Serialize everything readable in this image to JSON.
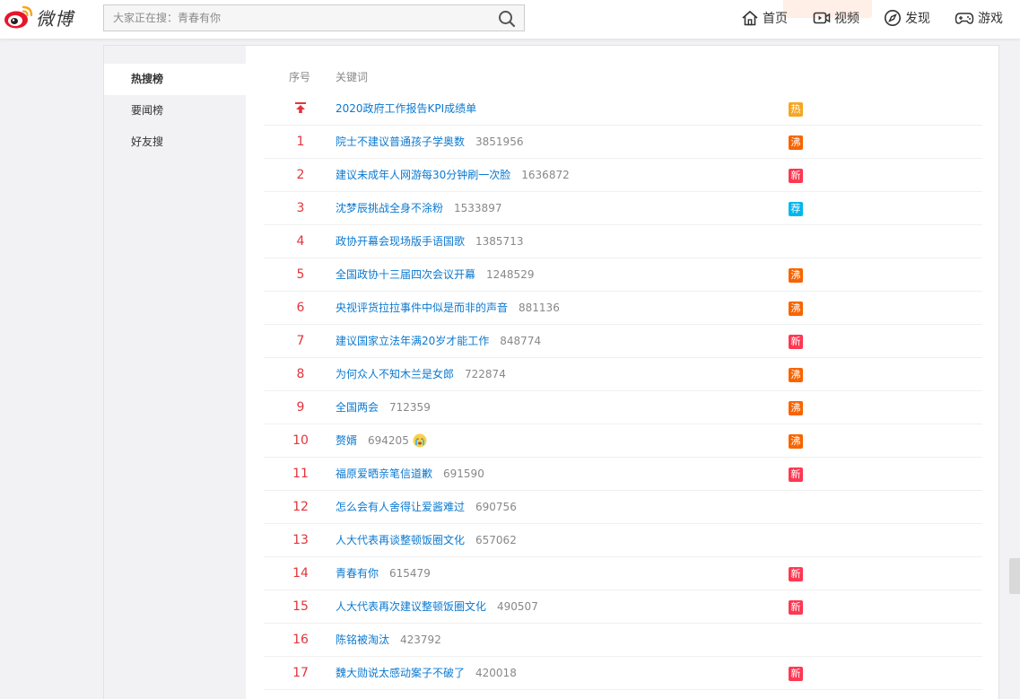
{
  "brand": {
    "name": "微博"
  },
  "search": {
    "placeholder": "大家正在搜：青春有你"
  },
  "nav": [
    {
      "label": "首页",
      "icon": "home-icon"
    },
    {
      "label": "视频",
      "icon": "video-icon"
    },
    {
      "label": "发现",
      "icon": "compass-icon"
    },
    {
      "label": "游戏",
      "icon": "gamepad-icon"
    }
  ],
  "sidebar": {
    "items": [
      {
        "label": "热搜榜",
        "active": true
      },
      {
        "label": "要闻榜",
        "active": false
      },
      {
        "label": "好友搜",
        "active": false
      }
    ]
  },
  "table": {
    "headers": {
      "rank": "序号",
      "keyword": "关键词"
    },
    "pinned": {
      "keyword": "2020政府工作报告KPI成绩单",
      "badge": "热",
      "badge_color": "#f5a623"
    },
    "rows": [
      {
        "rank": "1",
        "keyword": "院士不建议普通孩子学奥数",
        "count": "3851956",
        "badge": "沸",
        "badge_color": "#f86400"
      },
      {
        "rank": "2",
        "keyword": "建议未成年人网游每30分钟刷一次脸",
        "count": "1636872",
        "badge": "新",
        "badge_color": "#ff3852"
      },
      {
        "rank": "3",
        "keyword": "沈梦辰挑战全身不涂粉",
        "count": "1533897",
        "badge": "荐",
        "badge_color": "#00b7ee"
      },
      {
        "rank": "4",
        "keyword": "政协开幕会现场版手语国歌",
        "count": "1385713",
        "badge": "",
        "badge_color": ""
      },
      {
        "rank": "5",
        "keyword": "全国政协十三届四次会议开幕",
        "count": "1248529",
        "badge": "沸",
        "badge_color": "#f86400"
      },
      {
        "rank": "6",
        "keyword": "央视评货拉拉事件中似是而非的声音",
        "count": "881136",
        "badge": "沸",
        "badge_color": "#f86400"
      },
      {
        "rank": "7",
        "keyword": "建议国家立法年满20岁才能工作",
        "count": "848774",
        "badge": "新",
        "badge_color": "#ff3852"
      },
      {
        "rank": "8",
        "keyword": "为何众人不知木兰是女郎",
        "count": "722874",
        "badge": "沸",
        "badge_color": "#f86400"
      },
      {
        "rank": "9",
        "keyword": "全国两会",
        "count": "712359",
        "badge": "沸",
        "badge_color": "#f86400"
      },
      {
        "rank": "10",
        "keyword": "赘婿",
        "count": "694205",
        "badge": "沸",
        "badge_color": "#f86400",
        "emoji": "crying-face-icon"
      },
      {
        "rank": "11",
        "keyword": "福原爱晒亲笔信道歉",
        "count": "691590",
        "badge": "新",
        "badge_color": "#ff3852"
      },
      {
        "rank": "12",
        "keyword": "怎么会有人舍得让爱酱难过",
        "count": "690756",
        "badge": "",
        "badge_color": ""
      },
      {
        "rank": "13",
        "keyword": "人大代表再谈整顿饭圈文化",
        "count": "657062",
        "badge": "",
        "badge_color": ""
      },
      {
        "rank": "14",
        "keyword": "青春有你",
        "count": "615479",
        "badge": "新",
        "badge_color": "#ff3852"
      },
      {
        "rank": "15",
        "keyword": "人大代表再次建议整顿饭圈文化",
        "count": "490507",
        "badge": "新",
        "badge_color": "#ff3852"
      },
      {
        "rank": "16",
        "keyword": "陈铭被淘汰",
        "count": "423792",
        "badge": "",
        "badge_color": ""
      },
      {
        "rank": "17",
        "keyword": "魏大勋说太感动案子不破了",
        "count": "420018",
        "badge": "新",
        "badge_color": "#ff3852"
      }
    ]
  }
}
